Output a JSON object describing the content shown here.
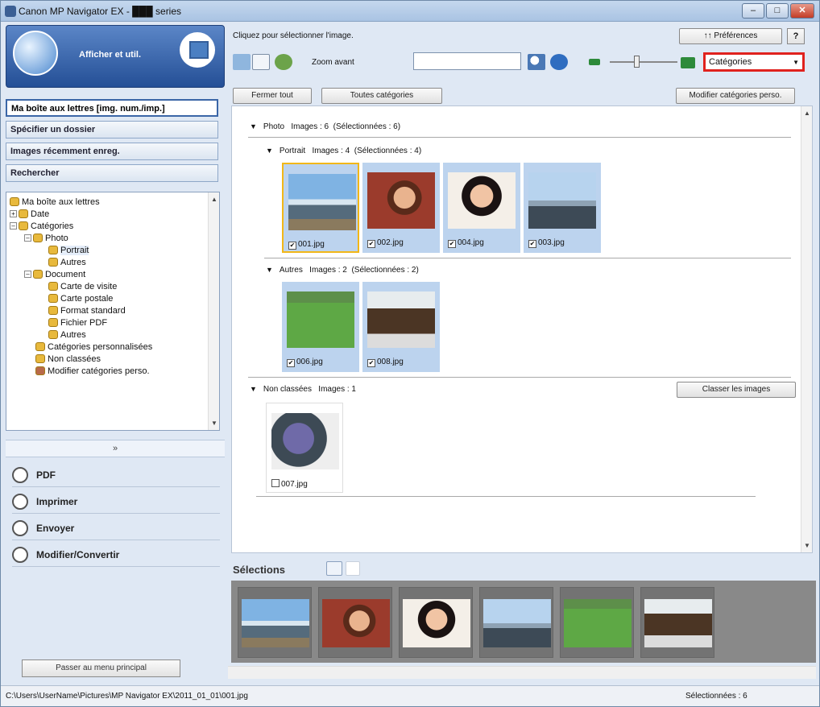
{
  "window": {
    "title": "Canon MP Navigator EX - ███ series"
  },
  "left": {
    "header_title": "Afficher et util.",
    "nav": [
      {
        "label": "Ma boîte aux lettres [img. num./imp.]"
      },
      {
        "label": "Spécifier un dossier"
      },
      {
        "label": "Images récemment enreg."
      },
      {
        "label": "Rechercher"
      }
    ],
    "tree": [
      {
        "label": "Ma boîte aux lettres"
      },
      {
        "label": "Date"
      },
      {
        "label": "Catégories"
      },
      {
        "label": "Photo"
      },
      {
        "label": "Portrait"
      },
      {
        "label": "Autres"
      },
      {
        "label": "Document"
      },
      {
        "label": "Carte de visite"
      },
      {
        "label": "Carte postale"
      },
      {
        "label": "Format standard"
      },
      {
        "label": "Fichier PDF"
      },
      {
        "label": "Autres"
      },
      {
        "label": "Catégories personnalisées"
      },
      {
        "label": "Non classées"
      },
      {
        "label": "Modifier catégories perso."
      }
    ],
    "actions": [
      {
        "label": "PDF",
        "icon": "pdf-icon"
      },
      {
        "label": "Imprimer",
        "icon": "printer-icon"
      },
      {
        "label": "Envoyer",
        "icon": "mail-icon"
      },
      {
        "label": "Modifier/Convertir",
        "icon": "pencil-icon"
      }
    ],
    "back_button": "Passer au menu principal"
  },
  "right": {
    "hint": "Cliquez pour sélectionner l'image.",
    "preferences": "Préférences",
    "help": "?",
    "zoom_label": "Zoom avant",
    "search_value": "",
    "category_select": "Catégories",
    "close_all": "Fermer tout",
    "all_categories": "Toutes catégories",
    "edit_categories": "Modifier catégories perso.",
    "classify_button": "Classer les images",
    "sections": {
      "photo": {
        "name": "Photo",
        "images": "Images : 6",
        "selected": "(Sélectionnées : 6)"
      },
      "portrait": {
        "name": "Portrait",
        "images": "Images : 4",
        "selected": "(Sélectionnées : 4)"
      },
      "autres": {
        "name": "Autres",
        "images": "Images : 2",
        "selected": "(Sélectionnées : 2)"
      },
      "nonclassees": {
        "name": "Non classées",
        "images": "Images : 1"
      }
    },
    "thumbs": {
      "portrait": [
        {
          "file": "001.jpg"
        },
        {
          "file": "002.jpg"
        },
        {
          "file": "004.jpg"
        },
        {
          "file": "003.jpg"
        }
      ],
      "autres": [
        {
          "file": "006.jpg"
        },
        {
          "file": "008.jpg"
        }
      ],
      "nonclassees": [
        {
          "file": "007.jpg"
        }
      ]
    },
    "selections_label": "Sélections"
  },
  "status": {
    "path": "C:\\Users\\UserName\\Pictures\\MP Navigator EX\\2011_01_01\\001.jpg",
    "selected": "Sélectionnées : 6"
  },
  "colors": {
    "highlight": "#e0221e",
    "selection_border": "#f2b718",
    "thumb_bg": "#bcd3ee"
  }
}
